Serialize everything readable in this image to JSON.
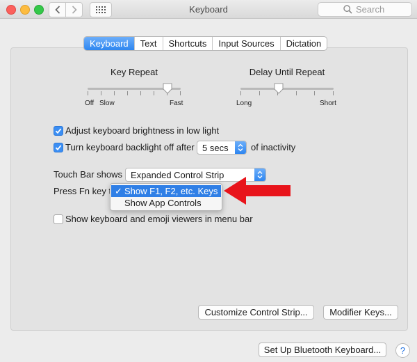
{
  "window": {
    "title": "Keyboard"
  },
  "search": {
    "placeholder": "Search"
  },
  "tabs": [
    {
      "label": "Keyboard",
      "active": true
    },
    {
      "label": "Text",
      "active": false
    },
    {
      "label": "Shortcuts",
      "active": false
    },
    {
      "label": "Input Sources",
      "active": false
    },
    {
      "label": "Dictation",
      "active": false
    }
  ],
  "key_repeat": {
    "title": "Key Repeat",
    "min_label_1": "Off",
    "min_label_2": "Slow",
    "max_label": "Fast",
    "level": 0.86
  },
  "delay_until_repeat": {
    "title": "Delay Until Repeat",
    "min_label": "Long",
    "max_label": "Short",
    "level": 0.41
  },
  "options": {
    "brightness": {
      "label": "Adjust keyboard brightness in low light",
      "checked": true
    },
    "backlight": {
      "label_before": "Turn keyboard backlight off after",
      "value": "5 secs",
      "label_after": "of inactivity",
      "checked": true
    },
    "touch_bar": {
      "label": "Touch Bar shows",
      "value": "Expanded Control Strip"
    },
    "fn_key": {
      "label": "Press Fn key to",
      "menu": [
        {
          "label": "Show F1, F2, etc. Keys",
          "selected": true
        },
        {
          "label": "Show App Controls",
          "selected": false
        }
      ]
    },
    "viewers": {
      "label": "Show keyboard and emoji viewers in menu bar",
      "checked": false
    }
  },
  "buttons": {
    "customize": "Customize Control Strip...",
    "modifier": "Modifier Keys...",
    "bluetooth": "Set Up Bluetooth Keyboard...",
    "help": "?"
  },
  "colors": {
    "accent": "#3b8ef3",
    "annotation_arrow": "#e8141b"
  }
}
